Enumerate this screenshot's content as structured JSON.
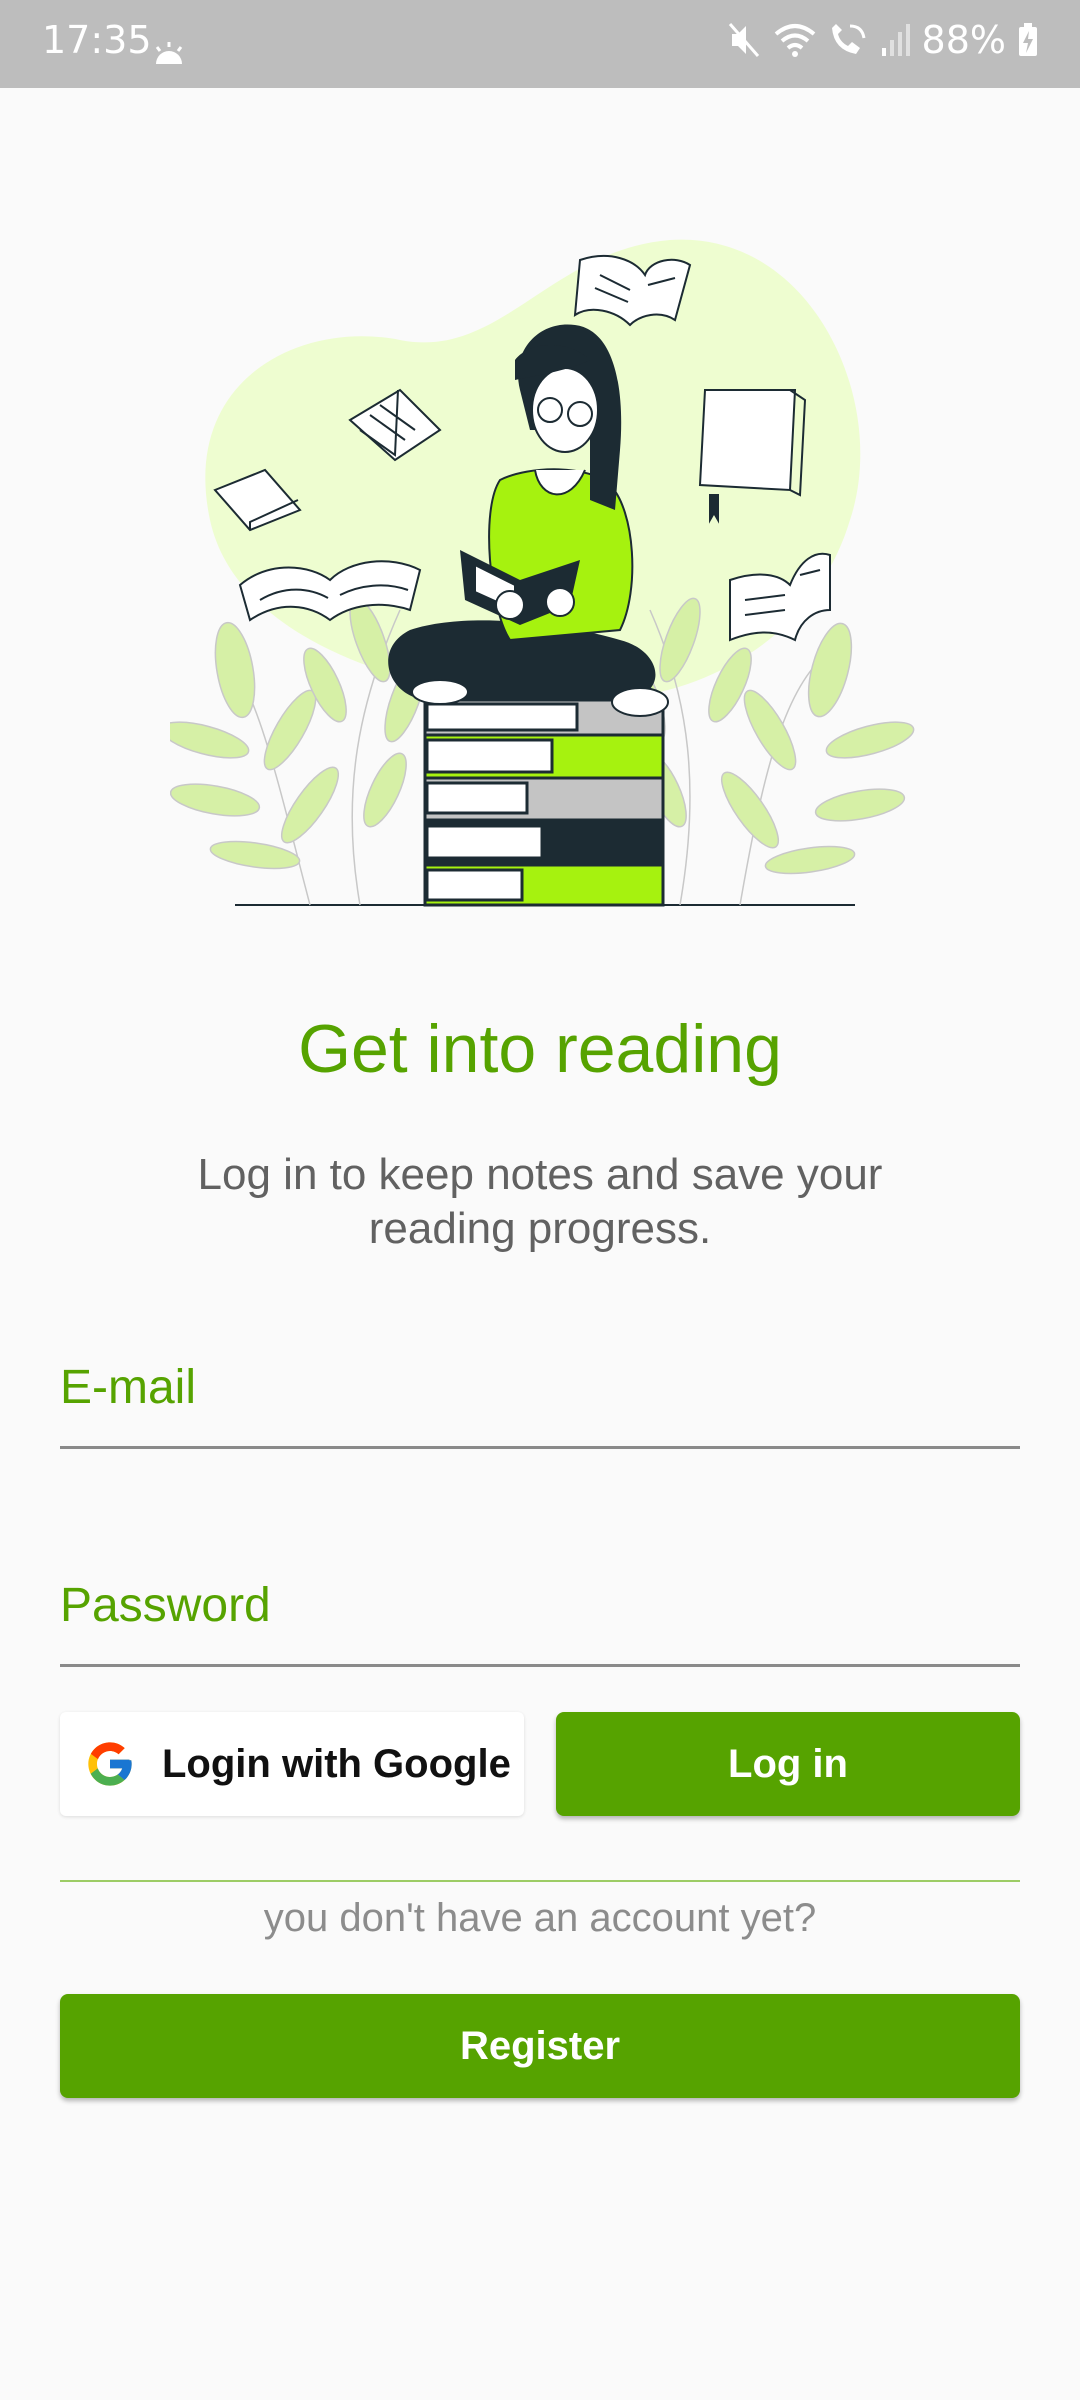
{
  "status_bar": {
    "time": "17:35",
    "battery": "88%",
    "icons": [
      "sun-weather-icon",
      "mute-icon",
      "wifi-icon",
      "wifi-calling-icon",
      "signal-icon",
      "battery-charging-icon"
    ]
  },
  "illustration": {
    "icon": "reading-woman-illustration",
    "colors": {
      "accent": "#a6f20f",
      "blob": "#eefdd0",
      "dark": "#1c2b33"
    }
  },
  "main": {
    "title": "Get into reading",
    "subtitle": "Log in to keep notes and save your reading progress."
  },
  "form": {
    "email_label": "E-mail",
    "password_label": "Password",
    "google_label": "Login with Google",
    "google_icon": "google-icon",
    "login_label": "Log in",
    "no_account_text": "you don't have an account yet?",
    "register_label": "Register"
  },
  "colors": {
    "primary": "#56a300",
    "background": "#fafafa",
    "status_bar": "#bdbdbd",
    "text_secondary": "#616161"
  }
}
